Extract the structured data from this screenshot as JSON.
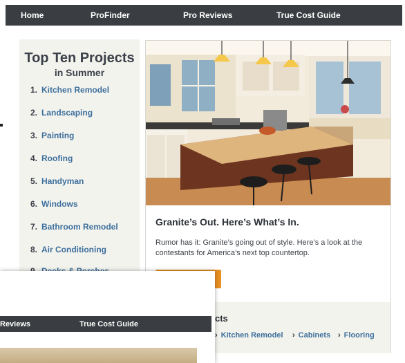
{
  "nav": {
    "home": "Home",
    "profinder": "ProFinder",
    "pro_reviews": "Pro Reviews",
    "true_cost_guide": "True Cost Guide"
  },
  "top_ten": {
    "title": "Top Ten Projects",
    "subtitle": "in Summer",
    "items": [
      {
        "num": "1.",
        "label": "Kitchen Remodel"
      },
      {
        "num": "2.",
        "label": "Landscaping"
      },
      {
        "num": "3.",
        "label": "Painting"
      },
      {
        "num": "4.",
        "label": "Roofing"
      },
      {
        "num": "5.",
        "label": "Handyman"
      },
      {
        "num": "6.",
        "label": "Windows"
      },
      {
        "num": "7.",
        "label": "Bathroom Remodel"
      },
      {
        "num": "8.",
        "label": "Air Conditioning"
      },
      {
        "num": "9.",
        "label": "Decks & Porches"
      }
    ]
  },
  "feature": {
    "title": "Granite’s Out. Here’s What’s In.",
    "description": "Rumor has it: Granite’s going out of style. Here’s a look at the contestants for America’s next top countertop.",
    "footer_heading": "cts",
    "footer_links": [
      "Kitchen Remodel",
      "Cabinets",
      "Flooring"
    ]
  },
  "overlay_nav": {
    "pro_reviews": "Reviews",
    "true_cost_guide": "True Cost Guide"
  },
  "colors": {
    "nav_bg": "#3a3d41",
    "link": "#3d6f9c",
    "accent_button": "#e88f22",
    "panel_bg": "#f3f3ee"
  }
}
